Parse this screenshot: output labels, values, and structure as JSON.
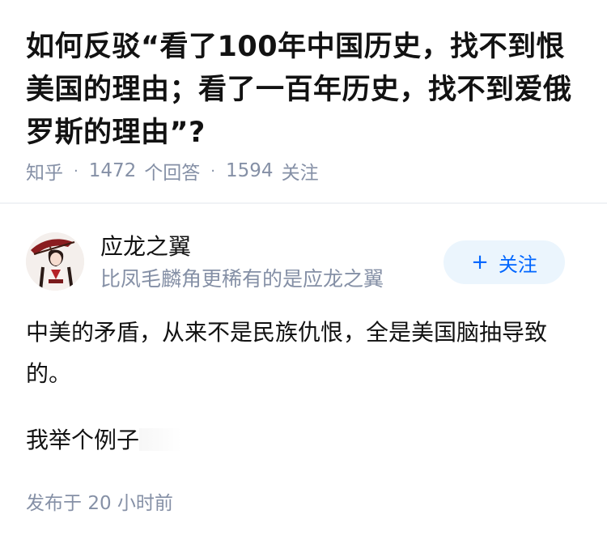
{
  "question": {
    "title": "如何反驳“看了100年中国历史，找不到恨美国的理由；看了一百年历史，找不到爱俄罗斯的理由”?",
    "source": "知乎",
    "answer_count": "1472",
    "answer_count_label": "个回答",
    "follower_count": "1594",
    "follower_count_label": "关注",
    "separator": "·"
  },
  "author": {
    "name": "应龙之翼",
    "bio": "比凤毛麟角更稀有的是应龙之翼",
    "avatar_icon": "avatar-illustration",
    "follow_plus": "+",
    "follow_label": "关注"
  },
  "answer": {
    "paragraph_1": "中美的矛盾，从来不是民族仇恨，全是美国脑抽导致的。",
    "paragraph_2": "我举个例子",
    "publish_prefix": "发布于",
    "publish_time": "20 小时前"
  },
  "colors": {
    "title": "#121212",
    "meta": "#8590a6",
    "follow_bg": "#ebf5fd",
    "follow_text": "#0066ff",
    "divider": "#f0f2f5"
  }
}
